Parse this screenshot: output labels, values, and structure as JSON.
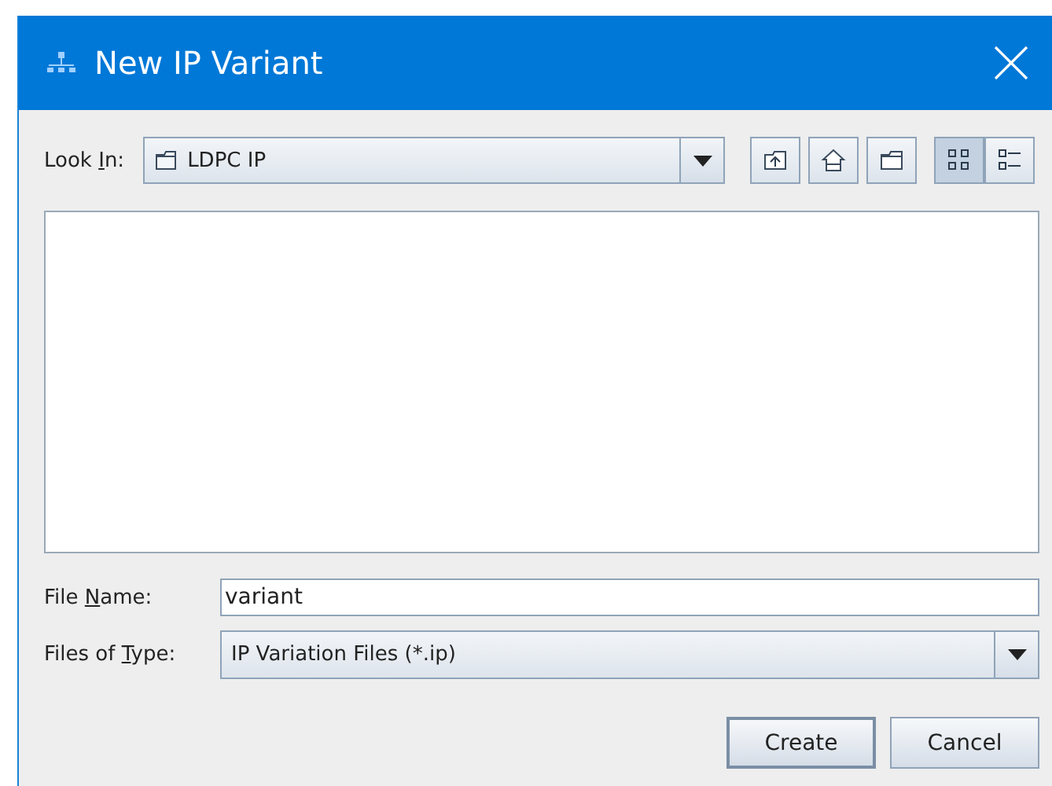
{
  "window": {
    "title": "New IP Variant"
  },
  "look_in": {
    "label": {
      "pre": "Look ",
      "key": "I",
      "post": "n:"
    },
    "value": "LDPC IP"
  },
  "toolbar": [
    {
      "kind": "up"
    },
    {
      "kind": "home"
    },
    {
      "kind": "new-folder"
    },
    {
      "kind": "list",
      "selected": true
    },
    {
      "kind": "details",
      "selected": false
    }
  ],
  "file_name": {
    "label": {
      "pre": "File ",
      "key": "N",
      "post": "ame:"
    },
    "value": "variant"
  },
  "file_type": {
    "label": {
      "pre": "Files of ",
      "key": "T",
      "post": "ype:"
    },
    "value": "IP Variation Files (*.ip)"
  },
  "buttons": [
    {
      "label": "Create",
      "default": true
    },
    {
      "label": "Cancel",
      "default": false
    }
  ]
}
